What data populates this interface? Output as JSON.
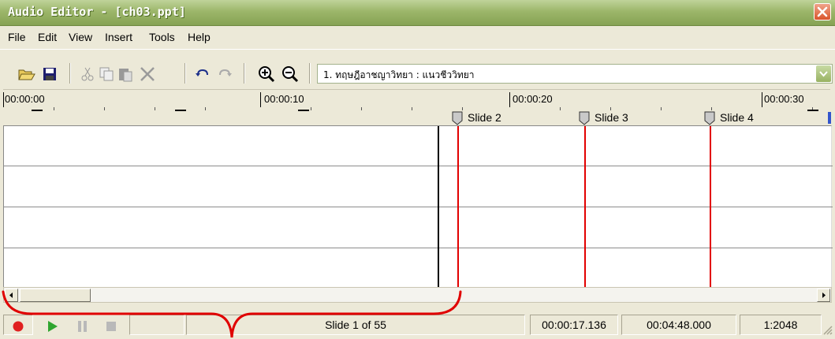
{
  "window": {
    "title": "Audio Editor - [ch03.ppt]"
  },
  "menu": [
    "File",
    "Edit",
    "View",
    "Insert",
    "Tools",
    "Help"
  ],
  "toolbar": {
    "icons": [
      "open-folder-icon",
      "save-icon",
      "cut-icon",
      "copy-icon",
      "paste-icon",
      "delete-icon",
      "undo-icon",
      "redo-icon",
      "zoom-in-icon",
      "zoom-out-icon"
    ],
    "slide_select": {
      "value": "1. ทฤษฎีอาชญาวิทยา : แนวชีววิทยา"
    }
  },
  "ruler": {
    "labels": [
      "00:00:00",
      "00:00:10",
      "00:00:20",
      "00:00:30"
    ],
    "slide_markers": [
      "Slide 2",
      "Slide 3",
      "Slide 4"
    ]
  },
  "status": {
    "slide_info": "Slide 1 of 55",
    "position": "00:00:17.136",
    "duration": "00:04:48.000",
    "ratio": "1:2048"
  },
  "colors": {
    "titlebar": "#9cb66a",
    "marker_line": "#e20000",
    "annotation": "#e00000",
    "play": "#2fa52f",
    "record": "#e02020"
  }
}
